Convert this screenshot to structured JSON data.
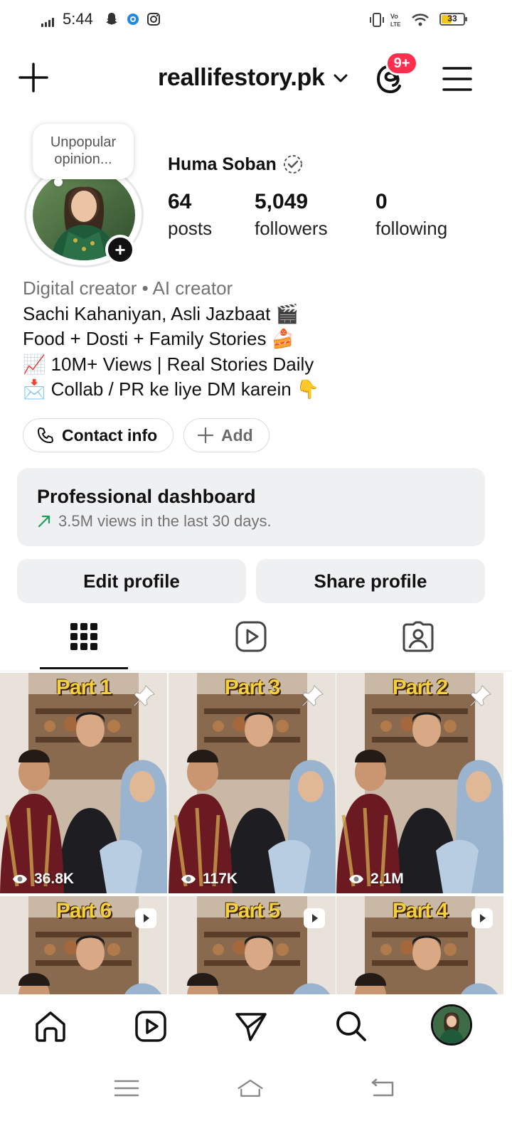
{
  "status_bar": {
    "time": "5:44",
    "battery": "33"
  },
  "header": {
    "username": "reallifestory.pk",
    "threads_badge": "9+",
    "icons": [
      "plus-icon",
      "chevron-down-icon",
      "threads-icon",
      "hamburger-menu-icon"
    ]
  },
  "profile": {
    "note": "Unpopular opinion...",
    "name": "Huma Soban",
    "stats": [
      {
        "value": "64",
        "label": "posts"
      },
      {
        "value": "5,049",
        "label": "followers"
      },
      {
        "value": "0",
        "label": "following"
      }
    ],
    "bio": {
      "category": "Digital creator • AI creator",
      "lines": [
        "Sachi Kahaniyan, Asli Jazbaat 🎬",
        "Food + Dosti + Family Stories 🍰",
        "📈 10M+ Views | Real Stories Daily",
        "📩 Collab / PR ke liye DM karein 👇"
      ]
    },
    "contact_button": "Contact info",
    "add_button": "Add"
  },
  "dashboard": {
    "title": "Professional dashboard",
    "subtitle": "3.5M views in the last 30 days."
  },
  "actions": {
    "edit_profile": "Edit profile",
    "share_profile": "Share profile"
  },
  "tabs": [
    "grid-icon",
    "reels-icon",
    "tagged-icon"
  ],
  "posts": [
    {
      "part": "Part 1",
      "views": "36.8K",
      "badge": "pin"
    },
    {
      "part": "Part 3",
      "views": "117K",
      "badge": "pin"
    },
    {
      "part": "Part 2",
      "views": "2.1M",
      "badge": "pin"
    },
    {
      "part": "Part 6",
      "views": "",
      "badge": "reel"
    },
    {
      "part": "Part 5",
      "views": "",
      "badge": "reel"
    },
    {
      "part": "Part 4",
      "views": "",
      "badge": "reel"
    }
  ],
  "bottom_nav": [
    "home-icon",
    "reels-icon",
    "direct-message-icon",
    "search-icon",
    "profile-avatar"
  ],
  "colors": {
    "badge_red": "#ff2d4e",
    "panel_gray": "#eff0f2",
    "muted_text": "#737373",
    "trend_green": "#1a9e5b"
  }
}
